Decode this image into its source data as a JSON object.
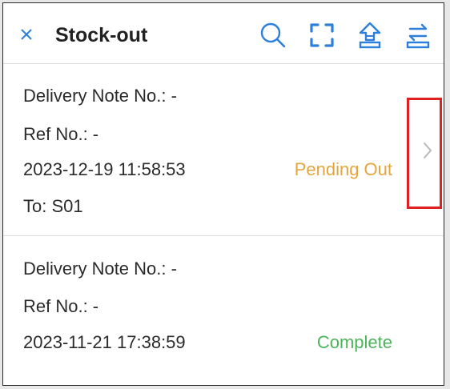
{
  "header": {
    "title": "Stock-out",
    "close_icon": "close-icon",
    "actions": [
      "search-icon",
      "scan-icon",
      "upload-icon",
      "transfer-icon"
    ],
    "accent_color": "#2d7fdc"
  },
  "records": [
    {
      "delivery_note": "Delivery Note No.: -",
      "ref_no": "Ref No.: -",
      "datetime": "2023-12-19 11:58:53",
      "status": "Pending Out",
      "status_color": "#e6a53c",
      "to": "To: S01"
    },
    {
      "delivery_note": "Delivery Note No.: -",
      "ref_no": "Ref No.: -",
      "datetime": "2023-11-21 17:38:59",
      "status": "Complete",
      "status_color": "#4cb55a"
    }
  ]
}
